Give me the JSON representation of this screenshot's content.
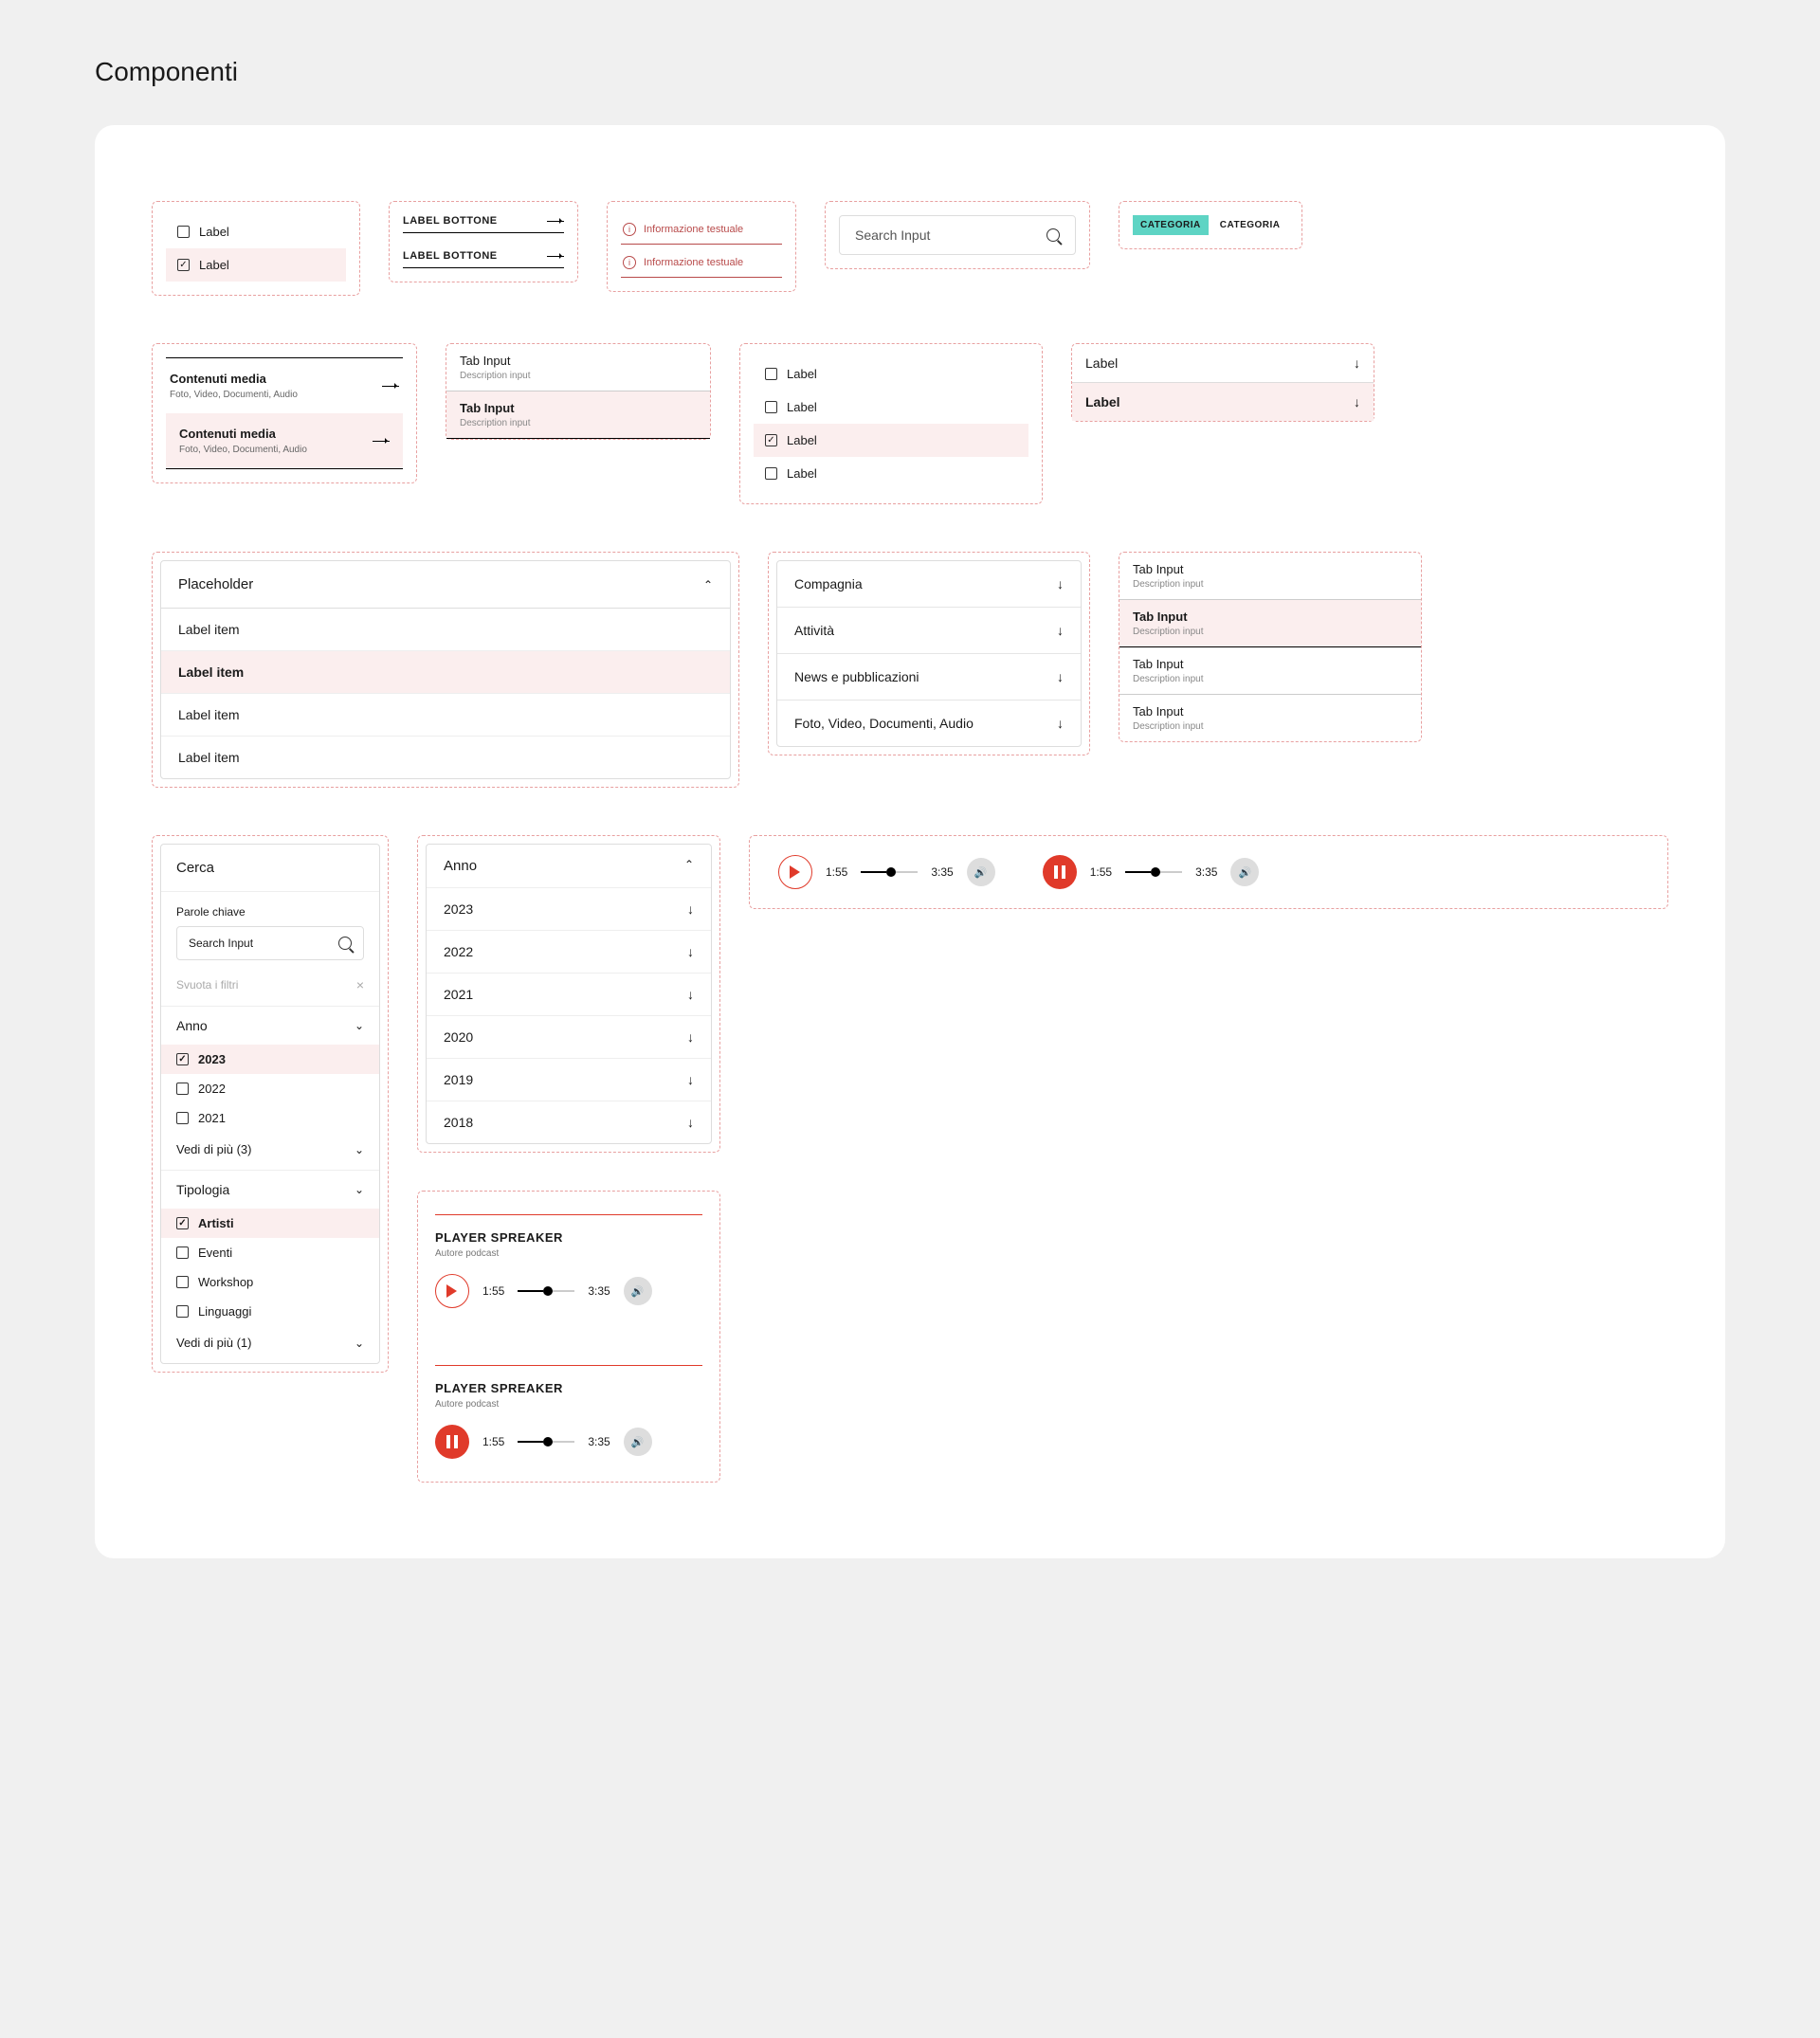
{
  "page_title": "Componenti",
  "row1": {
    "checklist": [
      {
        "label": "Label",
        "checked": false
      },
      {
        "label": "Label",
        "checked": true
      }
    ],
    "button_labels": [
      "LABEL BOTTONE",
      "LABEL BOTTONE"
    ],
    "info_texts": [
      "Informazione testuale",
      "Informazione testuale"
    ],
    "search_placeholder": "Search Input",
    "categories": [
      "CATEGORIA",
      "CATEGORIA"
    ]
  },
  "row2": {
    "media_cards": [
      {
        "title": "Contenuti media",
        "sub": "Foto, Video, Documenti, Audio"
      },
      {
        "title": "Contenuti media",
        "sub": "Foto, Video, Documenti, Audio"
      }
    ],
    "tab_inputs": [
      {
        "title": "Tab Input",
        "sub": "Description input"
      },
      {
        "title": "Tab Input",
        "sub": "Description input"
      }
    ],
    "check_col": [
      "Label",
      "Label",
      "Label",
      "Label"
    ],
    "check_col_selected": 2,
    "expand_labels": [
      "Label",
      "Label"
    ]
  },
  "row3": {
    "dropdown": {
      "placeholder": "Placeholder",
      "items": [
        "Label item",
        "Label item",
        "Label item",
        "Label item"
      ],
      "selected": 1
    },
    "nav_items": [
      "Compagnia",
      "Attività",
      "News e pubblicazioni",
      "Foto, Video, Documenti, Audio"
    ],
    "tab_inputs4": [
      {
        "title": "Tab Input",
        "sub": "Description input"
      },
      {
        "title": "Tab Input",
        "sub": "Description input"
      },
      {
        "title": "Tab Input",
        "sub": "Description input"
      },
      {
        "title": "Tab Input",
        "sub": "Description input"
      }
    ],
    "tab_selected": 1
  },
  "row4": {
    "cerca": {
      "title": "Cerca",
      "kw_label": "Parole chiave",
      "search_ph": "Search Input",
      "clear_label": "Svuota i filtri",
      "anno_title": "Anno",
      "anno_items": [
        "2023",
        "2022",
        "2021"
      ],
      "anno_selected": 0,
      "vedi_anno": "Vedi di più (3)",
      "tipo_title": "Tipologia",
      "tipo_items": [
        "Artisti",
        "Eventi",
        "Workshop",
        "Linguaggi"
      ],
      "tipo_selected": 0,
      "vedi_tipo": "Vedi di più (1)"
    },
    "anno_list": {
      "title": "Anno",
      "years": [
        "2023",
        "2022",
        "2021",
        "2020",
        "2019",
        "2018"
      ]
    },
    "players": {
      "t_current": "1:55",
      "t_total": "3:35"
    }
  },
  "row5": {
    "player_full": {
      "title": "PLAYER SPREAKER",
      "author": "Autore podcast",
      "t_current": "1:55",
      "t_total": "3:35"
    }
  }
}
